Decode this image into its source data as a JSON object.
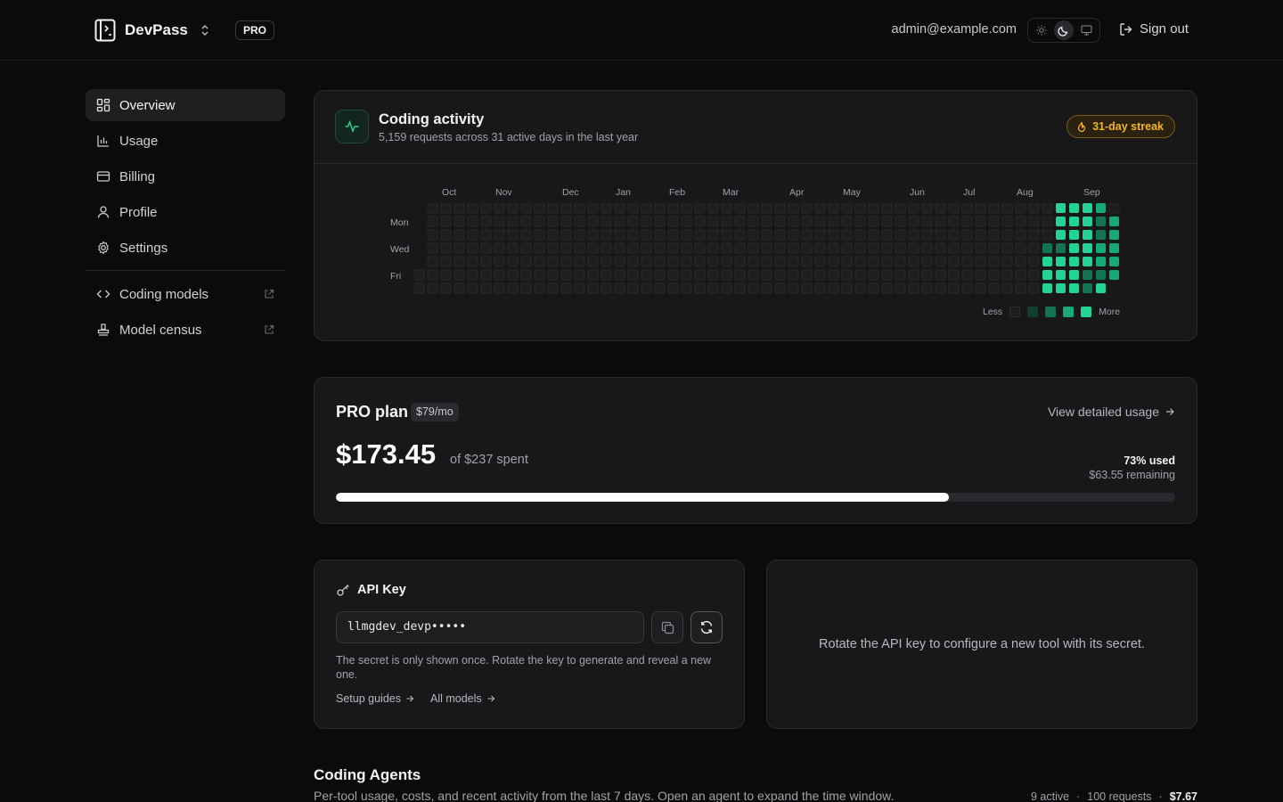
{
  "header": {
    "brand_name": "DevPass",
    "plan_badge": "PRO",
    "user_email": "admin@example.com",
    "theme_options": [
      "light",
      "dark",
      "system"
    ],
    "theme_selected": "dark",
    "sign_out_label": "Sign out"
  },
  "sidebar": {
    "items": [
      {
        "label": "Overview",
        "icon": "overview-icon",
        "active": true
      },
      {
        "label": "Usage",
        "icon": "chart-icon",
        "active": false
      },
      {
        "label": "Billing",
        "icon": "credit-card-icon",
        "active": false
      },
      {
        "label": "Profile",
        "icon": "user-icon",
        "active": false
      },
      {
        "label": "Settings",
        "icon": "gear-icon",
        "active": false
      }
    ],
    "external_links": [
      {
        "label": "Coding models",
        "icon": "code-icon"
      },
      {
        "label": "Model census",
        "icon": "stamp-icon"
      }
    ]
  },
  "activity": {
    "title": "Coding activity",
    "subtitle": "5,159 requests across 31 active days in the last year",
    "streak_label": "31-day streak",
    "months": [
      "Oct",
      "Nov",
      "Dec",
      "Jan",
      "Feb",
      "Mar",
      "Apr",
      "May",
      "Jun",
      "Jul",
      "Aug",
      "Sep"
    ],
    "day_labels": [
      "Mon",
      "Wed",
      "Fri"
    ],
    "legend_less": "Less",
    "legend_more": "More",
    "level_colors": [
      "#1e1e21",
      "#10412f",
      "#127451",
      "#17a877",
      "#22d394"
    ],
    "recent_levels": [
      [
        0,
        0,
        0,
        0,
        0,
        0,
        0
      ],
      [
        0,
        0,
        0,
        2,
        4,
        4,
        4
      ],
      [
        4,
        4,
        4,
        2,
        4,
        4,
        4
      ],
      [
        4,
        4,
        4,
        4,
        4,
        4,
        4
      ],
      [
        4,
        4,
        4,
        4,
        4,
        2,
        2
      ],
      [
        3,
        2,
        2,
        3,
        3,
        2,
        4
      ],
      [
        0,
        3,
        3,
        3,
        3,
        3,
        0
      ]
    ]
  },
  "plan": {
    "title": "PRO plan",
    "price": "$79/mo",
    "detail_link": "View detailed usage",
    "spent": "$173.45",
    "spent_of": "of $237 spent",
    "used_pct_label": "73% used",
    "remaining": "$63.55 remaining",
    "used_fraction": 0.73
  },
  "api_key": {
    "title": "API Key",
    "masked_value": "llmgdev_devp•••••",
    "note": "The secret is only shown once. Rotate the key to generate and reveal a new one.",
    "setup_link": "Setup guides",
    "models_link": "All models"
  },
  "rotate_panel": {
    "message": "Rotate the API key to configure a new tool with its secret."
  },
  "agents": {
    "title": "Coding Agents",
    "subtitle": "Per-tool usage, costs, and recent activity from the last 7 days. Open an agent to expand the time window.",
    "active": "9 active",
    "requests": "100 requests",
    "cost": "$7.67"
  }
}
